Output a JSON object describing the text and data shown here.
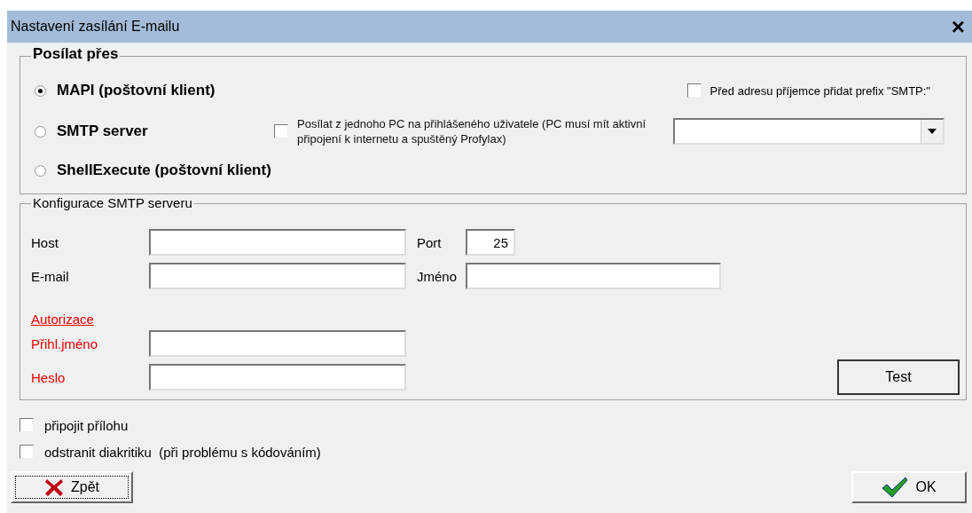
{
  "window": {
    "title": "Nastavení zasílání E-mailu",
    "close": "×"
  },
  "send_via": {
    "title": "Posílat přes",
    "options": [
      {
        "label": "MAPI (poštovní klient)",
        "selected": true
      },
      {
        "label": "SMTP server",
        "selected": false
      },
      {
        "label": "ShellExecute (poštovní klient)",
        "selected": false
      }
    ],
    "smtp_prefix": {
      "label": "Před adresu příjemce přidat prefix \"SMTP:\"",
      "checked": false
    },
    "single_pc": {
      "label": "Posílat z jednoho PC na přihlášeného uživatele (PC musí mít aktivní připojení k internetu a spuštěný Profylax)",
      "checked": false
    }
  },
  "smtp_config": {
    "title": "Konfigurace SMTP serveru",
    "host_label": "Host",
    "port_label": "Port",
    "port_value": "25",
    "email_label": "E-mail",
    "name_label": "Jméno",
    "auth_link": "Autorizace",
    "login_label": "Přihl.jméno",
    "password_label": "Heslo",
    "test_button": "Test"
  },
  "options": [
    {
      "label": "připojit přílohu",
      "checked": false
    },
    {
      "label": "odstranit diakritiku  (při problému s kódováním)",
      "checked": false
    }
  ],
  "buttons": {
    "back": "Zpět",
    "ok": "OK"
  }
}
